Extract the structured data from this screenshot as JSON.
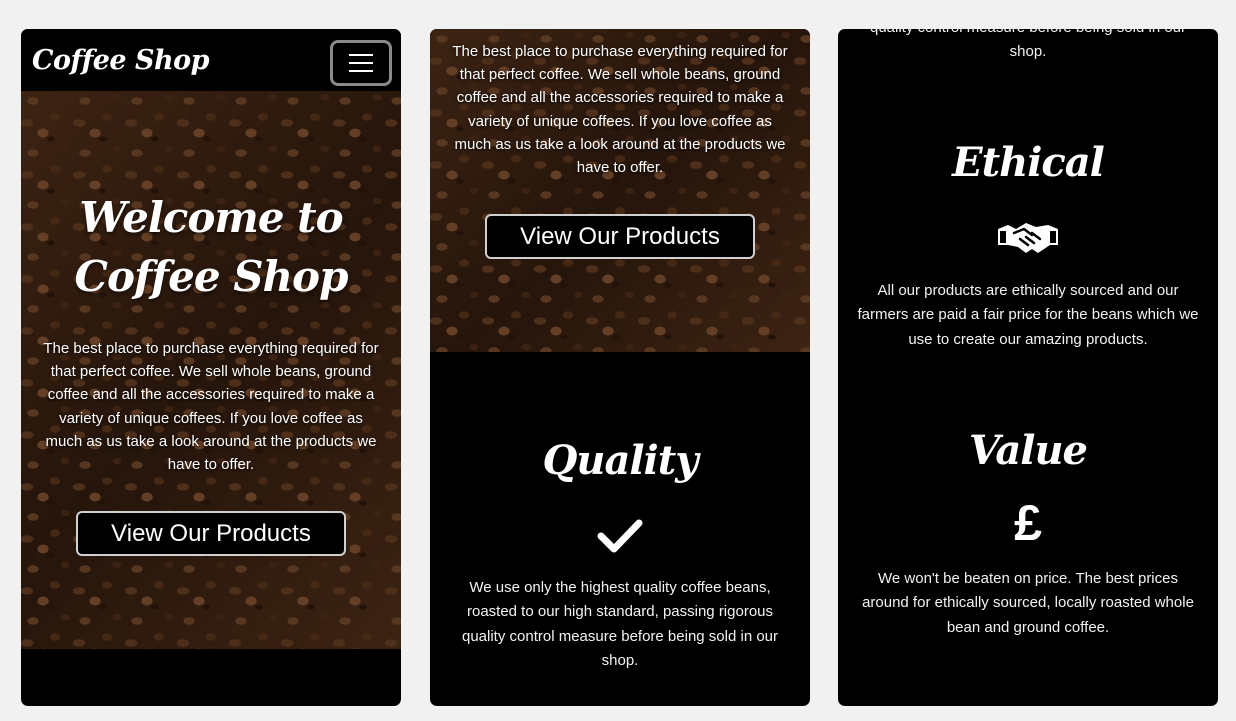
{
  "brand": "Coffee Shop",
  "hero": {
    "title_line1": "Welcome to",
    "title_line2": "Coffee Shop",
    "description": "The best place to purchase everything required for that perfect coffee. We sell whole beans, ground coffee and all the accessories required to make a variety of unique coffees. If you love coffee as much as us take a look around at the products we have to offer.",
    "cta_label": "View Our Products"
  },
  "features": [
    {
      "title": "Quality",
      "icon": "checkmark-icon",
      "text": "We use only the highest quality coffee beans, roasted to our high standard, passing rigorous quality control measure before being sold in our shop."
    },
    {
      "title": "Ethical",
      "icon": "handshake-icon",
      "text": "All our products are ethically sourced and our farmers are paid a fair price for the beans which we use to create our amazing products."
    },
    {
      "title": "Value",
      "icon": "pound-sign-icon",
      "symbol": "£",
      "text": "We won't be beaten on price. The best prices around for ethically sourced, locally roasted whole bean and ground coffee."
    }
  ],
  "scrolled_partial_text": "quality control measure before being sold in our shop."
}
